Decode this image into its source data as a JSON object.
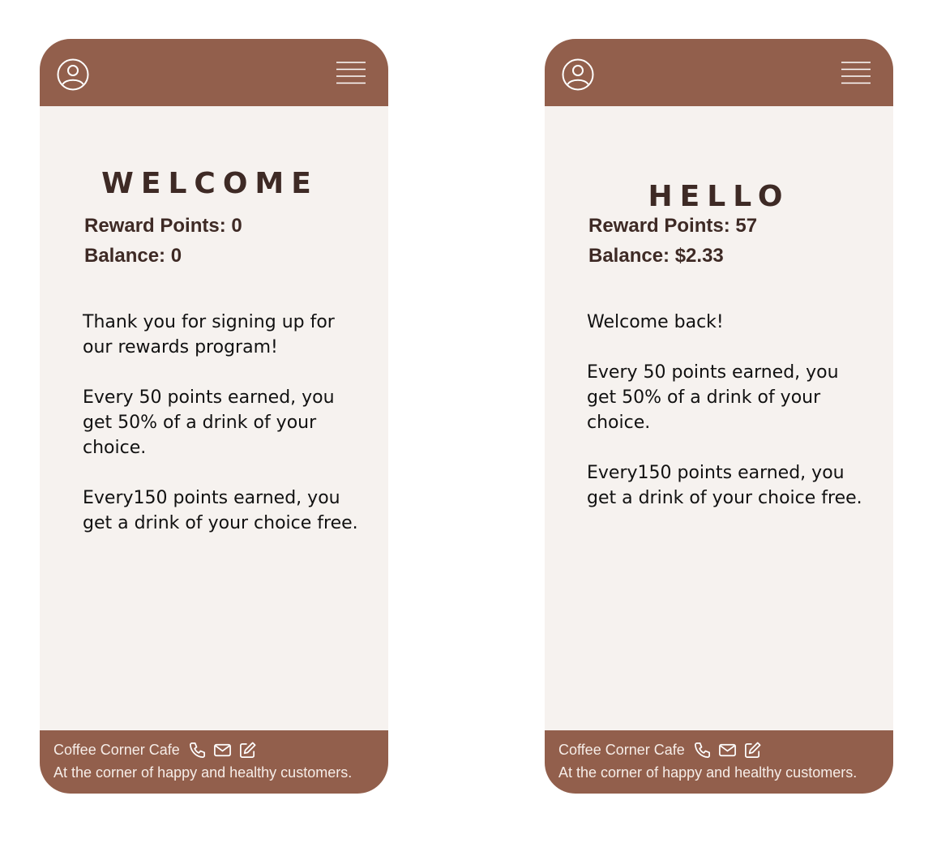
{
  "colors": {
    "brand_brown": "#925f4c",
    "background": "#f6f2ef",
    "heading_text": "#3e2a25",
    "footer_text": "#f6ede8"
  },
  "screens": [
    {
      "title": "WELCOME",
      "reward_points": "Reward Points: 0",
      "balance": "Balance: 0",
      "paragraphs": [
        "Thank you for signing up for our rewards program!",
        "Every 50 points earned, you get 50% of a drink of your choice.",
        "Every150 points earned, you get a drink of your choice free."
      ],
      "footer": {
        "name": "Coffee Corner Cafe",
        "tagline": "At the corner of happy and healthy customers."
      }
    },
    {
      "title": "HELLO",
      "reward_points": "Reward Points: 57",
      "balance": "Balance: $2.33",
      "paragraphs": [
        "Welcome back!",
        "Every 50 points earned, you get 50% of a drink of your choice.",
        "Every150 points earned, you get a drink of your choice free."
      ],
      "footer": {
        "name": "Coffee Corner Cafe",
        "tagline": "At the corner of happy and healthy customers."
      }
    }
  ],
  "icons": {
    "profile": "user-circle-icon",
    "menu": "hamburger-menu-icon",
    "phone": "phone-icon",
    "email": "mail-icon",
    "edit": "edit-icon"
  }
}
